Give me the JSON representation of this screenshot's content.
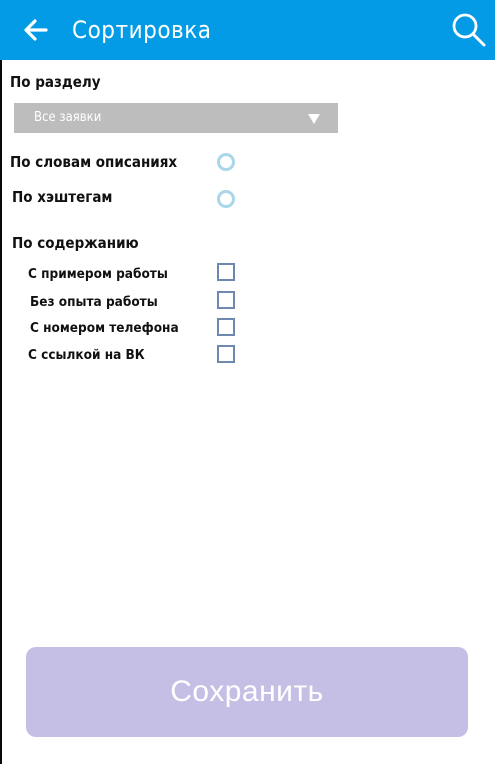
{
  "header": {
    "title": "Сортировка",
    "back_icon": "arrow-left-icon",
    "search_icon": "search-icon",
    "background": "#039be5"
  },
  "section": {
    "label": "По разделу",
    "select": {
      "value": "Все заявки",
      "icon": "triangle-down-icon"
    }
  },
  "filters": {
    "by_description": {
      "label": "По словам описаниях",
      "selected": false
    },
    "by_hashtag": {
      "label": "По хэштегам",
      "selected": false
    }
  },
  "content": {
    "label": "По содержанию",
    "items": [
      {
        "label": "С примером работы",
        "checked": false
      },
      {
        "label": "Без опыта работы",
        "checked": false
      },
      {
        "label": "С номером телефона",
        "checked": false
      },
      {
        "label": "С ссылкой на ВК",
        "checked": false
      }
    ]
  },
  "save_button": {
    "label": "Сохранить",
    "color": "#c5bfe6"
  }
}
